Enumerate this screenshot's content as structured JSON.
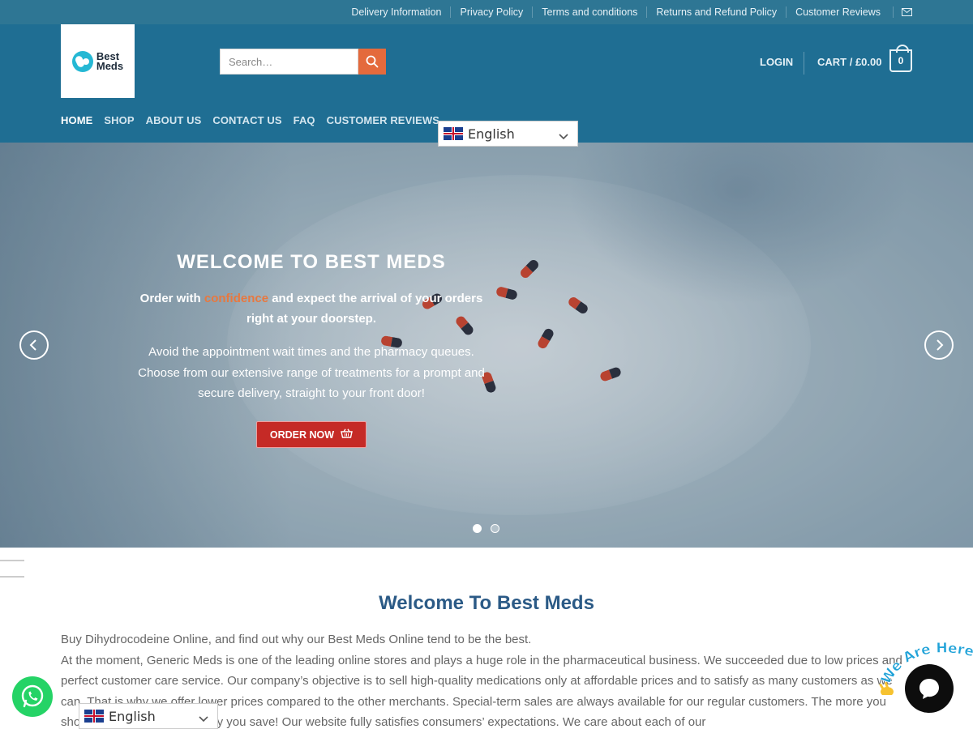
{
  "topbar": {
    "links": [
      "Delivery Information",
      "Privacy Policy",
      "Terms and conditions",
      "Returns and Refund Policy",
      "Customer Reviews"
    ],
    "mail_icon": "envelope-icon"
  },
  "header": {
    "logo_line1": "Best",
    "logo_line2": "Meds",
    "search_placeholder": "Search…",
    "login": "LOGIN",
    "cart_label": "CART / £0.00",
    "cart_count": "0"
  },
  "nav": {
    "items": [
      "HOME",
      "SHOP",
      "ABOUT US",
      "CONTACT US",
      "FAQ",
      "CUSTOMER REVIEWS"
    ],
    "active": "HOME"
  },
  "language": {
    "selected": "English"
  },
  "hero": {
    "title": "WELCOME TO BEST MEDS",
    "lead_before": "Order with ",
    "lead_highlight": "confidence",
    "lead_after": " and expect the arrival of your orders right at your doorstep.",
    "body": "Avoid the appointment wait times and the pharmacy queues. Choose from our extensive range of treatments for a prompt and secure delivery, straight to your front door!",
    "button": "ORDER NOW",
    "slides_total": 2,
    "slide_active": 1
  },
  "content": {
    "title": "Welcome To Best Meds",
    "para1": "Buy Dihydrocodeine Online, and find out why our Best Meds Online tend to be the best.",
    "para2": "At the moment, Generic Meds is one of the leading online stores and plays a huge role in the pharmaceutical business. We succeeded due to low prices and perfect customer care service. Our company’s objective is to sell high-quality medications only at affordable prices and to satisfy as many customers as we can. That is why we offer lower prices compared to the other merchants. Special-term sales are always available for our regular customers. The more you shop with us, the more money you save! Our website fully satisfies consumers’ expectations. We care about each of our"
  },
  "widgets": {
    "chat_tagline": "We Are Here!"
  },
  "colors": {
    "topbar": "#2e7694",
    "header": "#1f6e93",
    "accent": "#e46a3c",
    "order_button": "#c52a26",
    "heading": "#2b5a86"
  }
}
